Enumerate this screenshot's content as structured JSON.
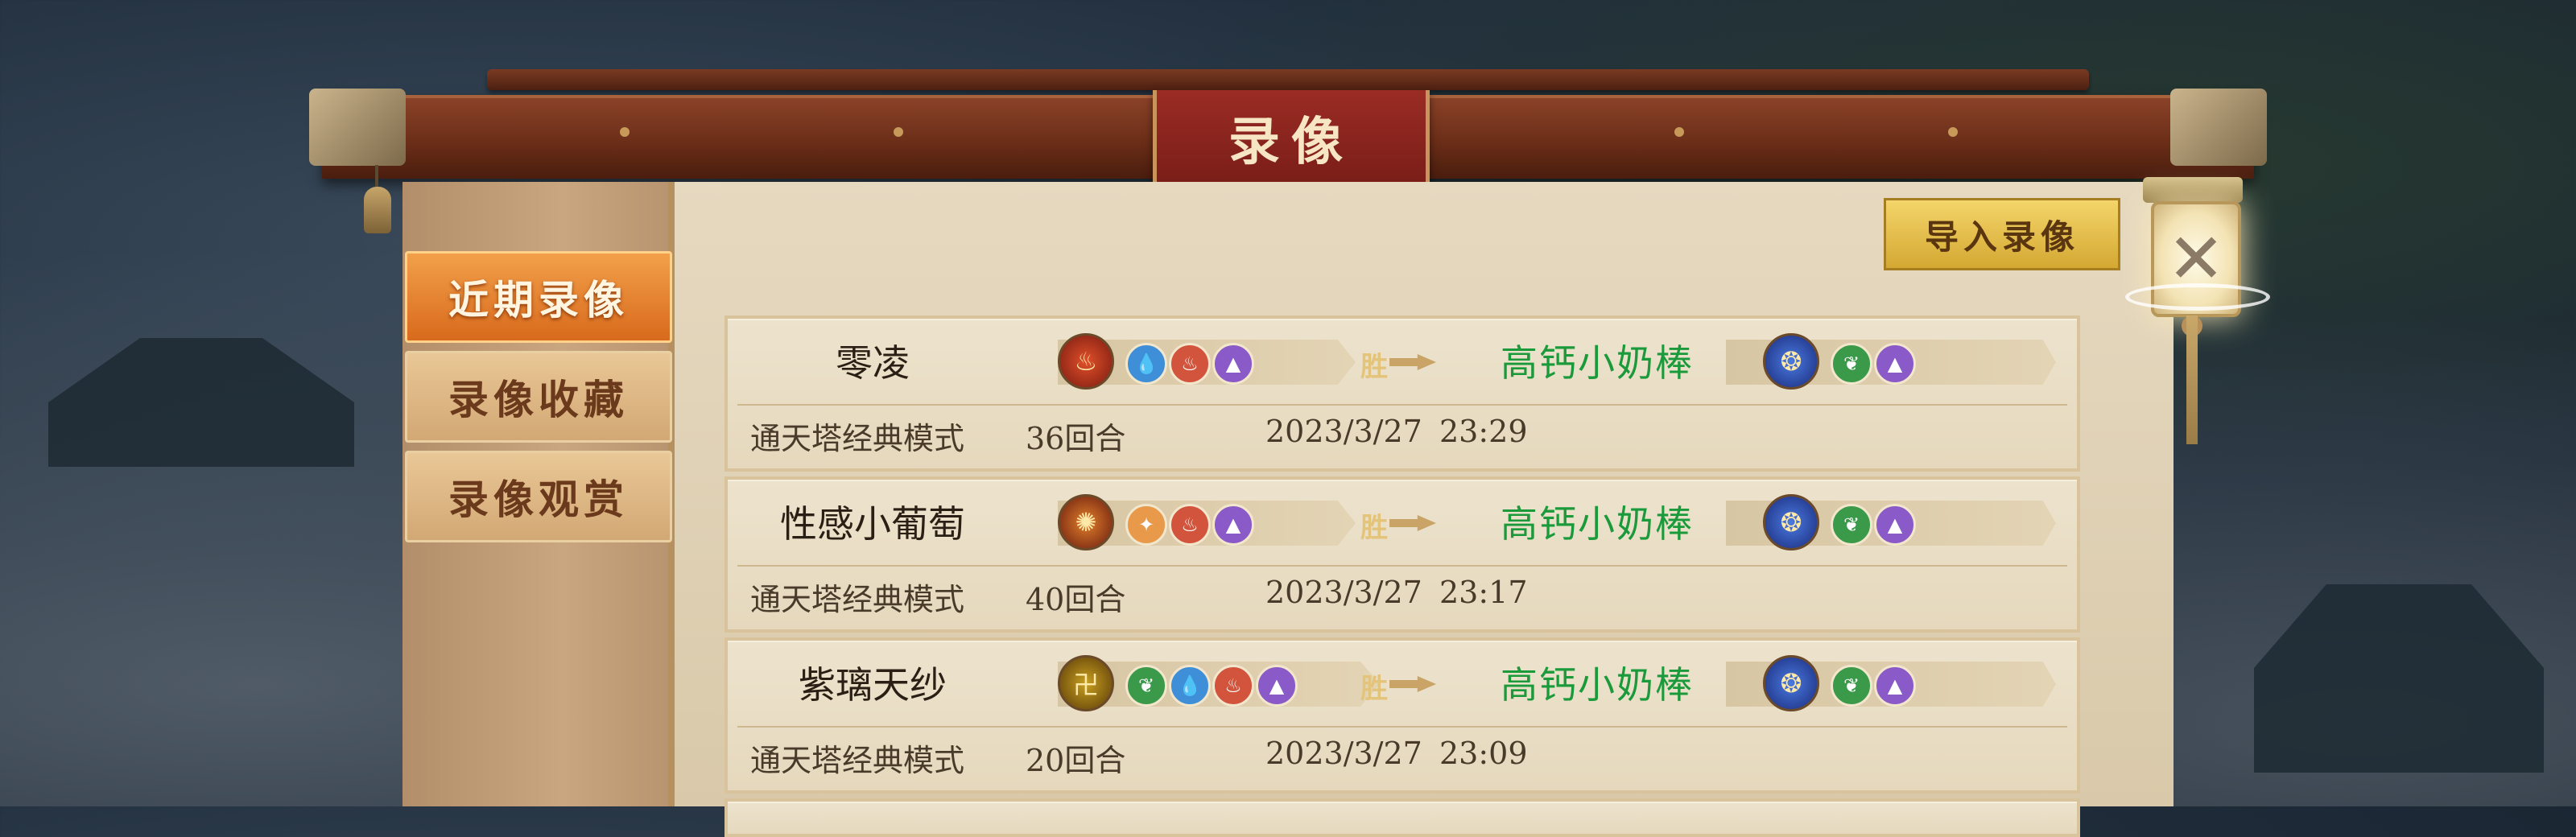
{
  "window": {
    "title": "录像"
  },
  "sidebar": {
    "tabs": [
      {
        "label": "近期录像",
        "active": true
      },
      {
        "label": "录像收藏",
        "active": false
      },
      {
        "label": "录像观赏",
        "active": false
      }
    ]
  },
  "toolbar": {
    "import_label": "导入录像"
  },
  "close_glyph": "✕",
  "colors": {
    "opponent_name": "#1a9a3a",
    "active_tab": "#e07a26",
    "title_plaque": "#8a241e"
  },
  "records": [
    {
      "player": "零凌",
      "player_avatar_icon": "fire-demon-avatar-icon",
      "player_elements": [
        "water-element-icon",
        "fire-element-icon",
        "mountain-element-icon"
      ],
      "result": "胜",
      "opponent": "高钙小奶棒",
      "opponent_avatar_icon": "blue-dragon-avatar-icon",
      "opponent_elements": [
        "wood-element-icon",
        "mountain-element-icon"
      ],
      "mode": "通天塔经典模式",
      "rounds": "36回合",
      "date": "2023/3/27",
      "time": "23:29"
    },
    {
      "player": "性感小葡萄",
      "player_avatar_icon": "phoenix-avatar-icon",
      "player_elements": [
        "light-element-icon",
        "fire-element-icon",
        "mountain-element-icon"
      ],
      "result": "胜",
      "opponent": "高钙小奶棒",
      "opponent_avatar_icon": "blue-dragon-avatar-icon",
      "opponent_elements": [
        "wood-element-icon",
        "mountain-element-icon"
      ],
      "mode": "通天塔经典模式",
      "rounds": "40回合",
      "date": "2023/3/27",
      "time": "23:17"
    },
    {
      "player": "紫璃天纱",
      "player_avatar_icon": "swastika-emblem-avatar-icon",
      "player_elements": [
        "wood-element-icon",
        "water-element-icon",
        "fire-element-icon",
        "mountain-element-icon"
      ],
      "result": "胜",
      "opponent": "高钙小奶棒",
      "opponent_avatar_icon": "blue-dragon-avatar-icon",
      "opponent_elements": [
        "wood-element-icon",
        "mountain-element-icon"
      ],
      "mode": "通天塔经典模式",
      "rounds": "20回合",
      "date": "2023/3/27",
      "time": "23:09"
    }
  ]
}
